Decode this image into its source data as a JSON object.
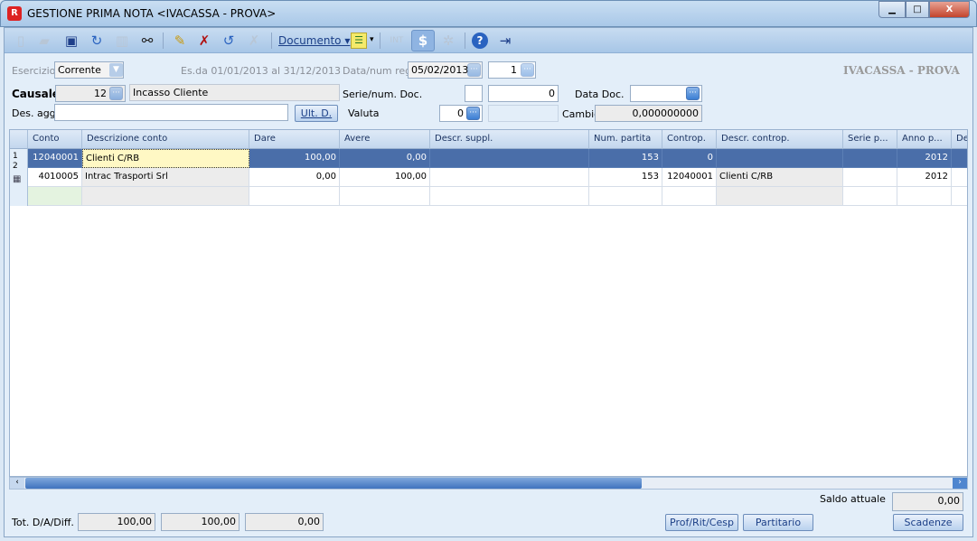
{
  "window": {
    "title": "GESTIONE PRIMA NOTA <IVACASSA - PROVA>",
    "minimize": "▁",
    "maximize": "□",
    "close": "X"
  },
  "toolbar": {
    "documento_label": "Documento",
    "int_label": "INT"
  },
  "form": {
    "esercizio_label": "Esercizio",
    "esercizio_value": "Corrente",
    "esercizio_range": "Es.da 01/01/2013 al 31/12/2013",
    "data_num_reg_label": "Data/num reg.",
    "data_reg_value": "05/02/2013",
    "num_reg_value": "1",
    "company": "IVACASSA - PROVA",
    "causale_label": "Causale",
    "causale_code": "12",
    "causale_desc": "Incasso Cliente",
    "serie_num_doc_label": "Serie/num. Doc.",
    "serie_doc_value": "",
    "num_doc_value": "0",
    "data_doc_label": "Data Doc.",
    "data_doc_value": "",
    "des_agg_label": "Des. agg.",
    "des_agg_value": "",
    "ult_d_label": "Ult. D.",
    "valuta_label": "Valuta",
    "valuta_value": "0",
    "valuta_desc": "",
    "cambio_label": "Cambio",
    "cambio_value": "0,000000000"
  },
  "grid": {
    "columns": [
      "Conto",
      "Descrizione conto",
      "Dare",
      "Avere",
      "Descr. suppl.",
      "Num. partita",
      "Controp.",
      "Descr. controp.",
      "Serie p...",
      "Anno p...",
      "De"
    ],
    "rows": [
      [
        "12040001",
        "Clienti C/RB",
        "100,00",
        "0,00",
        "",
        "153",
        "0",
        "",
        "",
        "2012",
        ""
      ],
      [
        "4010005",
        "Intrac Trasporti Srl",
        "0,00",
        "100,00",
        "",
        "153",
        "12040001",
        "Clienti C/RB",
        "",
        "2012",
        ""
      ],
      [
        "",
        "",
        "",
        "",
        "",
        "",
        "",
        "",
        "",
        "",
        ""
      ]
    ],
    "row_numbers": [
      "1",
      "2"
    ]
  },
  "footer": {
    "saldo_label": "Saldo attuale",
    "saldo_value": "0,00",
    "tot_label": "Tot. D/A/Diff.",
    "tot_dare": "100,00",
    "tot_avere": "100,00",
    "tot_diff": "0,00",
    "prof_button": "Prof/Rit/Cesp",
    "partitario_button": "Partitario",
    "scadenze_button": "Scadenze"
  }
}
